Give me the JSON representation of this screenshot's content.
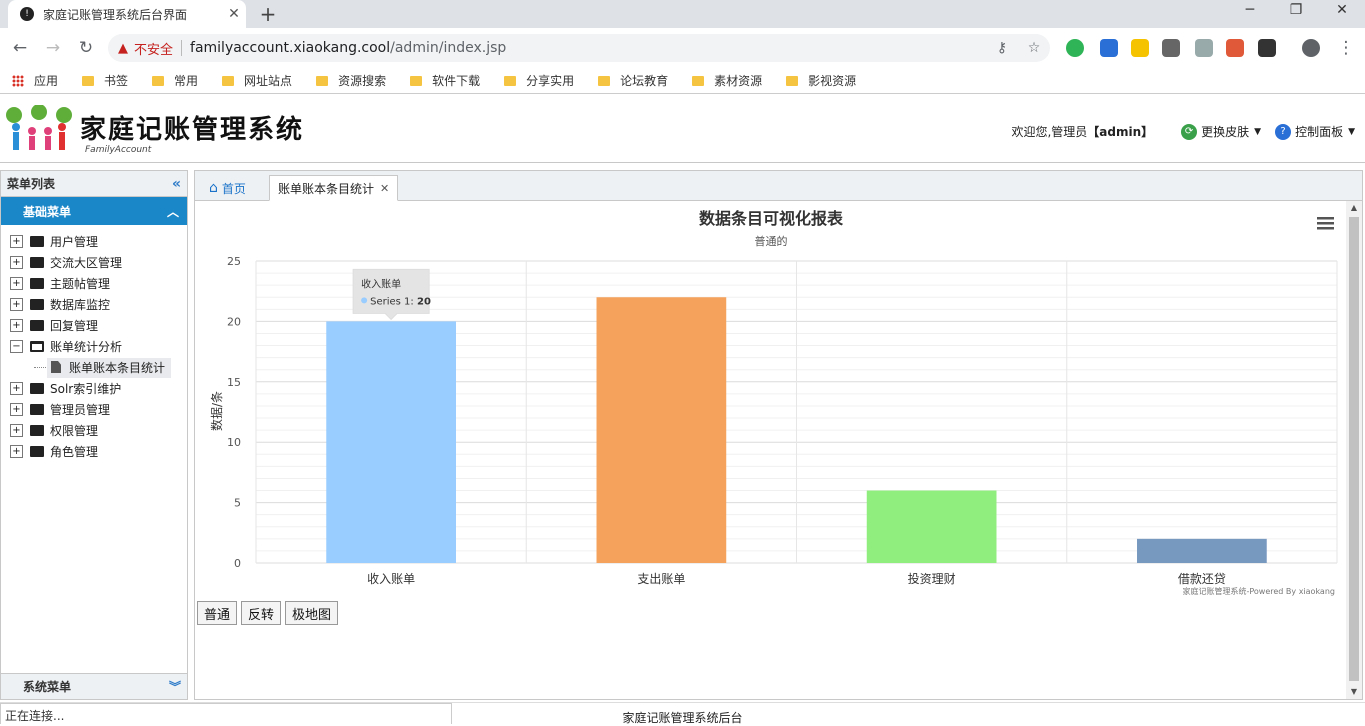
{
  "browser": {
    "tab_title": "家庭记账管理系统后台界面",
    "tab_close": "✕",
    "new_tab": "+",
    "insecure_label": "不安全",
    "url_host": "familyaccount.xiaokang.cool",
    "url_path": "/admin/index.jsp",
    "bookmarks": [
      "应用",
      "书签",
      "常用",
      "网址站点",
      "资源搜索",
      "软件下载",
      "分享实用",
      "论坛教育",
      "素材资源",
      "影视资源"
    ],
    "status_text": "正在连接..."
  },
  "header": {
    "logo_title": "家庭记账管理系统",
    "logo_subtitle": "FamilyAccount",
    "welcome_prefix": "欢迎您,管理员",
    "welcome_user": "【admin】",
    "skin_label": "更换皮肤",
    "control_label": "控制面板"
  },
  "sidebar": {
    "title": "菜单列表",
    "basic_menu": "基础菜单",
    "system_menu": "系统菜单",
    "items": [
      {
        "label": "用户管理",
        "expanded": false
      },
      {
        "label": "交流大区管理",
        "expanded": false
      },
      {
        "label": "主题帖管理",
        "expanded": false
      },
      {
        "label": "数据库监控",
        "expanded": false
      },
      {
        "label": "回复管理",
        "expanded": false
      },
      {
        "label": "账单统计分析",
        "expanded": true
      },
      {
        "label": "账单账本条目统计",
        "child": true
      },
      {
        "label": "Solr索引维护",
        "expanded": false
      },
      {
        "label": "管理员管理",
        "expanded": false
      },
      {
        "label": "权限管理",
        "expanded": false
      },
      {
        "label": "角色管理",
        "expanded": false
      }
    ]
  },
  "tabs": {
    "home": "首页",
    "active": "账单账本条目统计"
  },
  "chart_data": {
    "type": "bar",
    "title": "数据条目可视化报表",
    "subtitle": "普通的",
    "ylabel": "数据/条",
    "xlabel": "",
    "categories": [
      "收入账单",
      "支出账单",
      "投资理财",
      "借款还贷"
    ],
    "series": [
      {
        "name": "Series 1",
        "values": [
          20,
          22,
          6,
          2
        ]
      }
    ],
    "colors": [
      "#99ccff",
      "#f5a25d",
      "#90ee7e",
      "#7798bf"
    ],
    "ylim": [
      0,
      25
    ],
    "yticks": [
      0,
      5,
      10,
      15,
      20,
      25
    ],
    "grid": true,
    "credits": "家庭记账管理系统-Powered By xiaokang",
    "tooltip": {
      "category": "收入账单",
      "series": "Series 1",
      "value": "20"
    }
  },
  "chart_buttons": [
    "普通",
    "反转",
    "极地图"
  ],
  "footer": {
    "text": "家庭记账管理系统后台"
  }
}
